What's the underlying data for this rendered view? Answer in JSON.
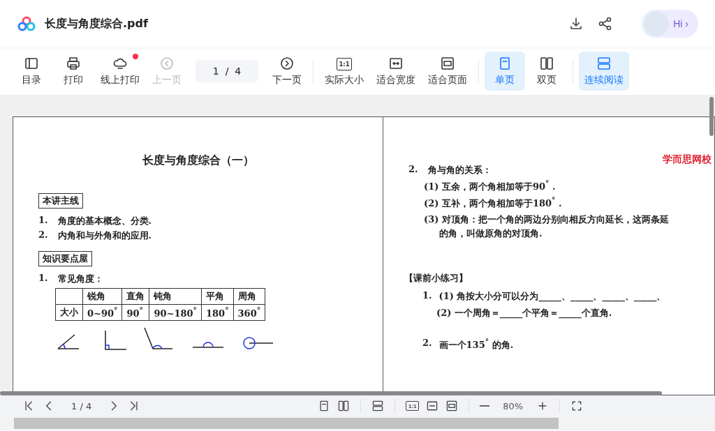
{
  "header": {
    "title": "长度与角度综合.pdf",
    "hi_button": {
      "label": "Hi",
      "arrow": "›"
    }
  },
  "toolbar": {
    "groups": [
      [
        {
          "kind": "button",
          "label": "目录",
          "disabled": false,
          "selected": false,
          "notification": false
        },
        {
          "kind": "button",
          "label": "打印",
          "disabled": false,
          "selected": false,
          "notification": false
        },
        {
          "kind": "button",
          "label": "线上打印",
          "disabled": false,
          "selected": false,
          "notification": true
        },
        {
          "kind": "button",
          "label": "上一页",
          "disabled": true,
          "selected": false,
          "notification": false
        },
        {
          "kind": "page",
          "value": "1  /  4"
        },
        {
          "kind": "button",
          "label": "下一页",
          "disabled": false,
          "selected": false,
          "notification": false
        }
      ],
      [
        {
          "kind": "button",
          "label": "实际大小",
          "glyph": "1:1",
          "disabled": false,
          "selected": false,
          "notification": false
        },
        {
          "kind": "button",
          "label": "适合宽度",
          "disabled": false,
          "selected": false,
          "notification": false
        },
        {
          "kind": "button",
          "label": "适合页面",
          "disabled": false,
          "selected": false,
          "notification": false
        }
      ],
      [
        {
          "kind": "button",
          "label": "单页",
          "disabled": false,
          "selected": true,
          "notification": false
        },
        {
          "kind": "button",
          "label": "双页",
          "disabled": false,
          "selected": false,
          "notification": false
        }
      ],
      [
        {
          "kind": "button",
          "label": "连续阅读",
          "disabled": false,
          "selected": true,
          "notification": false
        }
      ]
    ]
  },
  "left_page": {
    "title": "长度与角度综合（一）",
    "blocks": [
      {
        "kind": "section",
        "text": "本讲主线"
      },
      {
        "kind": "item",
        "number": "1.",
        "text": "角度的基本概念、分类."
      },
      {
        "kind": "item",
        "number": "2.",
        "text": "内角和与外角和的应用."
      },
      {
        "kind": "section",
        "text": "知识要点屋"
      },
      {
        "kind": "item",
        "number": "1.",
        "text": "常见角度："
      }
    ],
    "table": {
      "columns": [
        "",
        "锐角",
        "直角",
        "钝角",
        "平角",
        "周角"
      ],
      "rows": [
        [
          "大小",
          "0~90$^{°}$",
          "90$^{°}$",
          "90~180$^{°}$",
          "180$^{°}$",
          "360$^{°}$"
        ]
      ]
    }
  },
  "right_page": {
    "logo": "学而思网校",
    "blocks": [
      {
        "kind": "item",
        "number": "2.",
        "text": "角与角的关系："
      },
      {
        "kind": "sub",
        "text": "(1) 互余，两个角相加等于**90**$^{°}$ ."
      },
      {
        "kind": "sub",
        "text": "(2) 互补，两个角相加等于**180**$^{°}$ ."
      },
      {
        "kind": "sub",
        "text": "(3) 对顶角：把一个角的两边分别向相反方向延长，这两条延"
      },
      {
        "kind": "cont",
        "text": "的角，叫做原角的对顶角."
      },
      {
        "kind": "heading",
        "text": "【课前小练习】"
      },
      {
        "kind": "exercise",
        "number": "1.",
        "text": "(1) 角按大小分可以分为_____、_____、_____、_____、"
      },
      {
        "kind": "cont2",
        "text": "(2) 一个周角＝_____个平角＝_____个直角."
      },
      {
        "kind": "exercise",
        "number": "2.",
        "text": "画一个**135**$^{°}$ 的角."
      }
    ]
  },
  "bottom_bar": {
    "page": "1 / 4",
    "zoom": "80%",
    "glyph": "1:1"
  }
}
